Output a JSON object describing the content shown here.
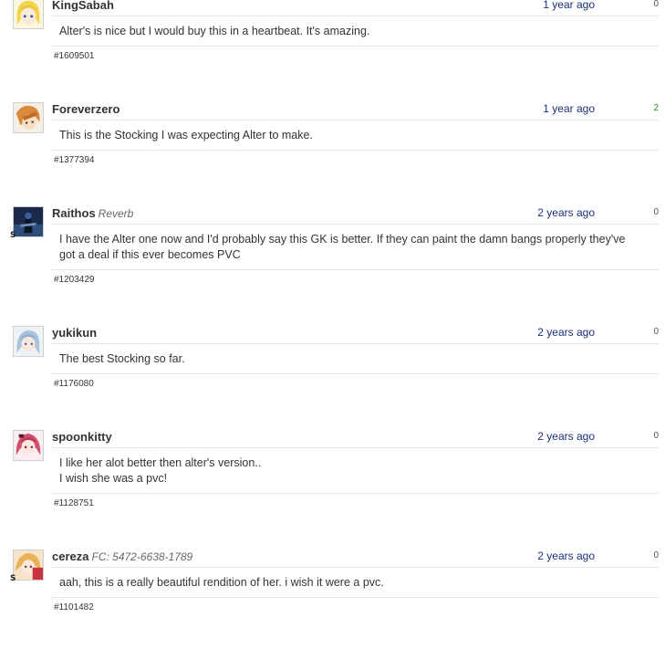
{
  "comments": [
    {
      "username": "KingSabah",
      "tag": "",
      "time": "1 year ago",
      "score": "0",
      "lines": [
        "Alter's is nice but I would buy this in a heartbeat. It's amazing."
      ],
      "id": "#1609501",
      "badge": "",
      "avatar_icon": "blonde-anime-girl-avatar-icon"
    },
    {
      "username": "Foreverzero",
      "tag": "",
      "time": "1 year ago",
      "score": "2",
      "lines": [
        "This is the Stocking I was expecting Alter to make."
      ],
      "id": "#1377394",
      "badge": "",
      "avatar_icon": "orange-haired-avatar-icon"
    },
    {
      "username": "Raithos",
      "tag": "Reverb",
      "time": "2 years ago",
      "score": "0",
      "lines": [
        "I have the Alter one now and I'd probably say this GK is better. If they can paint the damn bangs properly they've",
        "got a deal if this ever becomes PVC"
      ],
      "id": "#1203429",
      "badge": "S",
      "avatar_icon": "dark-blue-figure-avatar-icon"
    },
    {
      "username": "yukikun",
      "tag": "",
      "time": "2 years ago",
      "score": "0",
      "lines": [
        "The best Stocking so far."
      ],
      "id": "#1176080",
      "badge": "",
      "avatar_icon": "light-blue-haired-avatar-icon"
    },
    {
      "username": "spoonkitty",
      "tag": "",
      "time": "2 years ago",
      "score": "0",
      "lines": [
        "I like her alot better then alter's version..",
        "I wish she was a pvc!"
      ],
      "id": "#1128751",
      "badge": "",
      "avatar_icon": "pink-haired-avatar-icon"
    },
    {
      "username": "cereza",
      "tag": "FC: 5472-6638-1789",
      "time": "2 years ago",
      "score": "0",
      "lines": [
        "aah, this is a really beautiful rendition of her. i wish it were a pvc."
      ],
      "id": "#1101482",
      "badge": "S",
      "avatar_icon": "blonde-red-avatar-icon"
    }
  ],
  "colors": {
    "link": "#1a2f7a",
    "positive_score": "#2e8b2e",
    "divider": "#e3e3e3"
  }
}
